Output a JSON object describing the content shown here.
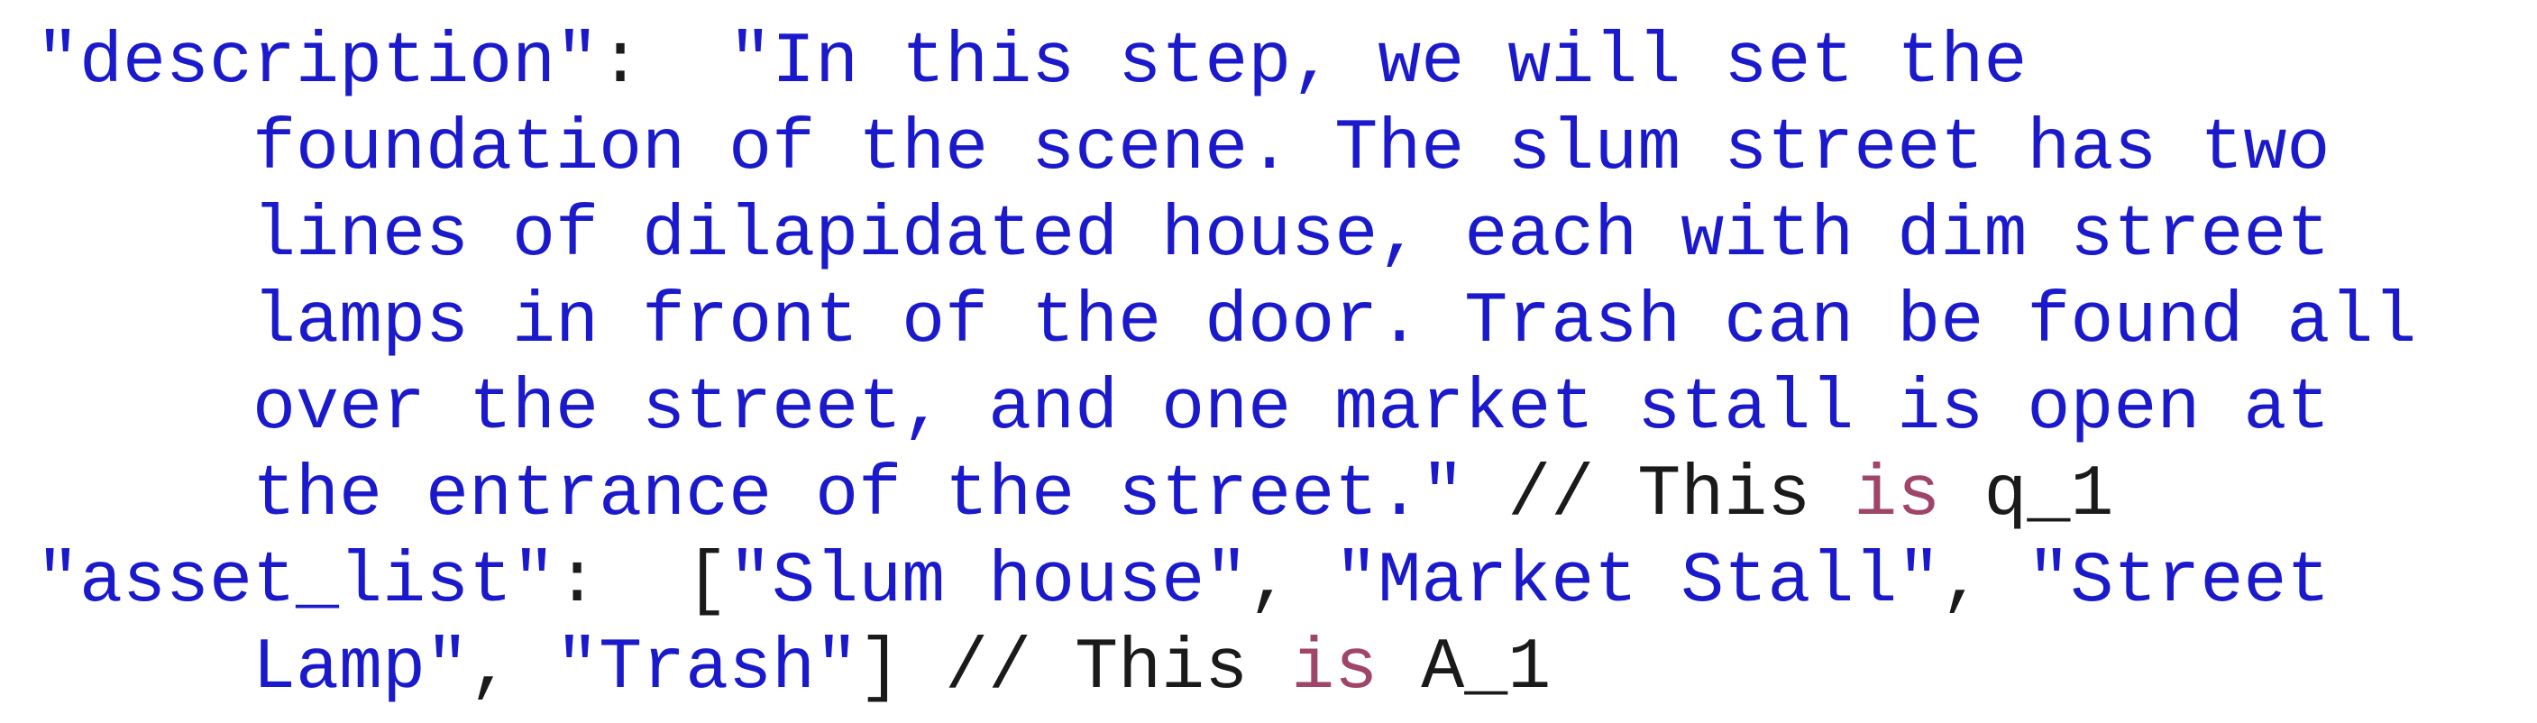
{
  "lines": [
    {
      "parts": [
        {
          "cls": "str",
          "text": "\"description\""
        },
        {
          "cls": "txt",
          "text": ":  "
        },
        {
          "cls": "str",
          "text": "\"In this step, we will set the"
        }
      ]
    },
    {
      "indent": true,
      "parts": [
        {
          "cls": "str",
          "text": "foundation of the scene. The slum street has two"
        }
      ]
    },
    {
      "indent": true,
      "parts": [
        {
          "cls": "str",
          "text": "lines of dilapidated house, each with dim street"
        }
      ]
    },
    {
      "indent": true,
      "parts": [
        {
          "cls": "str",
          "text": "lamps in front of the door. Trash can be found all"
        }
      ]
    },
    {
      "indent": true,
      "parts": [
        {
          "cls": "str",
          "text": "over the street, and one market stall is open at"
        }
      ]
    },
    {
      "indent": true,
      "parts": [
        {
          "cls": "str",
          "text": "the entrance of the street.\""
        },
        {
          "cls": "txt",
          "text": " // This "
        },
        {
          "cls": "kw",
          "text": "is"
        },
        {
          "cls": "txt",
          "text": " q_1"
        }
      ]
    },
    {
      "parts": [
        {
          "cls": "str",
          "text": "\"asset_list\""
        },
        {
          "cls": "txt",
          "text": ":  ["
        },
        {
          "cls": "str",
          "text": "\"Slum house\""
        },
        {
          "cls": "txt",
          "text": ", "
        },
        {
          "cls": "str",
          "text": "\"Market Stall\""
        },
        {
          "cls": "txt",
          "text": ", "
        },
        {
          "cls": "str",
          "text": "\"Street"
        }
      ]
    },
    {
      "indent": true,
      "parts": [
        {
          "cls": "str",
          "text": "Lamp\""
        },
        {
          "cls": "txt",
          "text": ", "
        },
        {
          "cls": "str",
          "text": "\"Trash\""
        },
        {
          "cls": "txt",
          "text": "] // This "
        },
        {
          "cls": "kw",
          "text": "is"
        },
        {
          "cls": "txt",
          "text": " A_1"
        }
      ]
    }
  ]
}
